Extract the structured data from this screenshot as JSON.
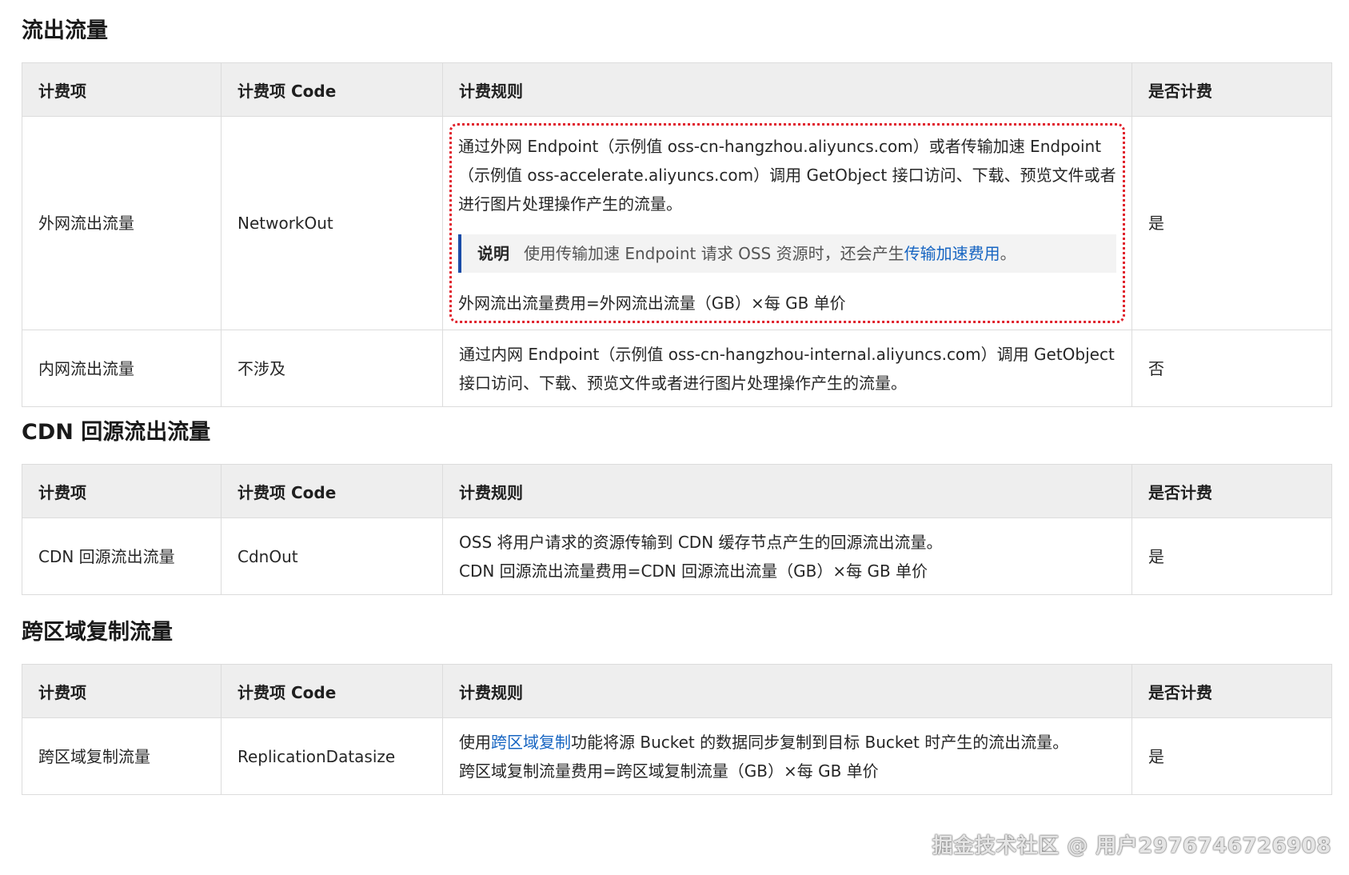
{
  "columns": {
    "item": "计费项",
    "code": "计费项 Code",
    "rule": "计费规则",
    "charged": "是否计费"
  },
  "sections": [
    {
      "title": "流出流量",
      "rows": [
        {
          "item": "外网流出流量",
          "code": "NetworkOut",
          "rule_text": "通过外网 Endpoint（示例值 oss-cn-hangzhou.aliyuncs.com）或者传输加速 Endpoint（示例值 oss-accelerate.aliyuncs.com）调用 GetObject 接口访问、下载、预览文件或者进行图片处理操作产生的流量。",
          "note_label": "说明",
          "note_text": "使用传输加速 Endpoint 请求 OSS 资源时，还会产生",
          "note_link": "传输加速费用",
          "note_tail": "。",
          "formula": "外网流出流量费用=外网流出流量（GB）×每 GB 单价",
          "charged": "是"
        },
        {
          "item": "内网流出流量",
          "code": "不涉及",
          "rule_text": "通过内网 Endpoint（示例值 oss-cn-hangzhou-internal.aliyuncs.com）调用 GetObject 接口访问、下载、预览文件或者进行图片处理操作产生的流量。",
          "charged": "否"
        }
      ]
    },
    {
      "title": "CDN 回源流出流量",
      "rows": [
        {
          "item": "CDN 回源流出流量",
          "code": "CdnOut",
          "rule_text": "OSS 将用户请求的资源传输到 CDN 缓存节点产生的回源流出流量。",
          "formula": "CDN 回源流出流量费用=CDN 回源流出流量（GB）×每 GB 单价",
          "charged": "是"
        }
      ]
    },
    {
      "title": "跨区域复制流量",
      "rows": [
        {
          "item": "跨区域复制流量",
          "code": "ReplicationDatasize",
          "rule_prefix": "使用",
          "rule_link": "跨区域复制",
          "rule_suffix": "功能将源 Bucket 的数据同步复制到目标 Bucket 时产生的流出流量。",
          "formula": "跨区域复制流量费用=跨区域复制流量（GB）×每 GB 单价",
          "charged": "是"
        }
      ]
    }
  ],
  "watermark": "掘金技术社区 @ 用户2976746726908",
  "colors": {
    "header_bg": "#eeeeee",
    "border": "#dcdcdc",
    "highlight_border": "#e0202b",
    "link": "#1765c2",
    "note_bar": "#1a4ca8"
  }
}
